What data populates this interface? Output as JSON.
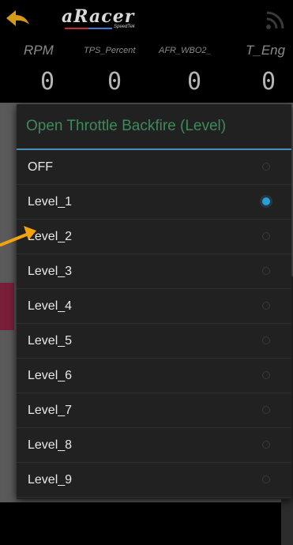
{
  "header": {
    "logo_text": "aRacer",
    "logo_sub": "SpeedTek",
    "icons": [
      "back-arrow-icon",
      "rss-feed-icon"
    ]
  },
  "gauges": [
    {
      "label": "RPM",
      "value": "0"
    },
    {
      "label": "TPS_Percent",
      "value": "0"
    },
    {
      "label": "AFR_WBO2_",
      "value": "0"
    },
    {
      "label": "T_Eng",
      "value": "0"
    }
  ],
  "dialog": {
    "title": "Open Throttle Backfire (Level)",
    "selected": "Level_1",
    "options": [
      {
        "label": "OFF",
        "checked": false
      },
      {
        "label": "Level_1",
        "checked": true
      },
      {
        "label": "Level_2",
        "checked": false
      },
      {
        "label": "Level_3",
        "checked": false
      },
      {
        "label": "Level_4",
        "checked": false
      },
      {
        "label": "Level_5",
        "checked": false
      },
      {
        "label": "Level_6",
        "checked": false
      },
      {
        "label": "Level_7",
        "checked": false
      },
      {
        "label": "Level_8",
        "checked": false
      },
      {
        "label": "Level_9",
        "checked": false
      }
    ]
  },
  "colors": {
    "accent": "#2a9fd6",
    "title_green": "#3f8a5a",
    "arrow": "#f2a20c"
  }
}
